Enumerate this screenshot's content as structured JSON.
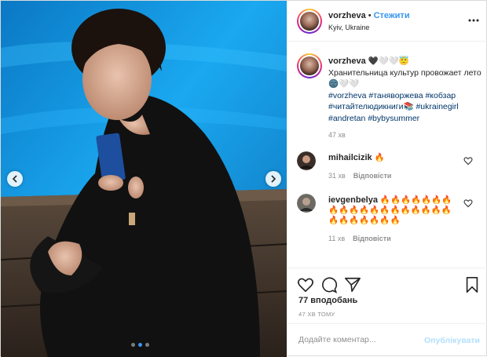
{
  "header": {
    "username": "vorzheva",
    "separator": "•",
    "follow_label": "Стежити",
    "location": "Kyiv, Ukraine",
    "more_icon": "more-dots-icon"
  },
  "caption": {
    "username": "vorzheva",
    "username_emoji": "🖤🤍🤍😇",
    "text": "Хранительница культур провожает лето 🌚🤍🤍",
    "hashtags": [
      "#vorzheva",
      "#таняворжева",
      "#кобзар",
      "#читайтелюдикниги📚",
      "#ukrainegirl",
      "#andretan",
      "#bybysummer"
    ],
    "time": "47 хв"
  },
  "comments": [
    {
      "username": "mihailcizik",
      "text": "🔥",
      "time": "31 хв",
      "reply_label": "Відповісти",
      "like_icon": "heart-outline-icon"
    },
    {
      "username": "ievgenbelya",
      "text": "🔥🔥🔥🔥🔥🔥🔥🔥🔥🔥🔥🔥🔥🔥🔥🔥🔥🔥🔥🔥🔥🔥🔥🔥🔥🔥",
      "time": "11 хв",
      "reply_label": "Відповісти",
      "like_icon": "heart-outline-icon"
    }
  ],
  "actions": {
    "icons": [
      "heart-outline-icon",
      "comment-icon",
      "share-icon",
      "bookmark-icon"
    ],
    "likes": "77 вподобань",
    "posted_ago": "47 ХВ ТОМУ"
  },
  "add_comment": {
    "placeholder": "Додайте коментар...",
    "publish_label": "Опублікувати"
  },
  "carousel": {
    "slide_count": 3,
    "active_slide": 2
  },
  "colors": {
    "accent": "#3897f0",
    "hashtag": "#003569",
    "muted": "#8e8e8e",
    "publish_disabled": "#b2dffc",
    "pool": "#0a8cd8"
  }
}
